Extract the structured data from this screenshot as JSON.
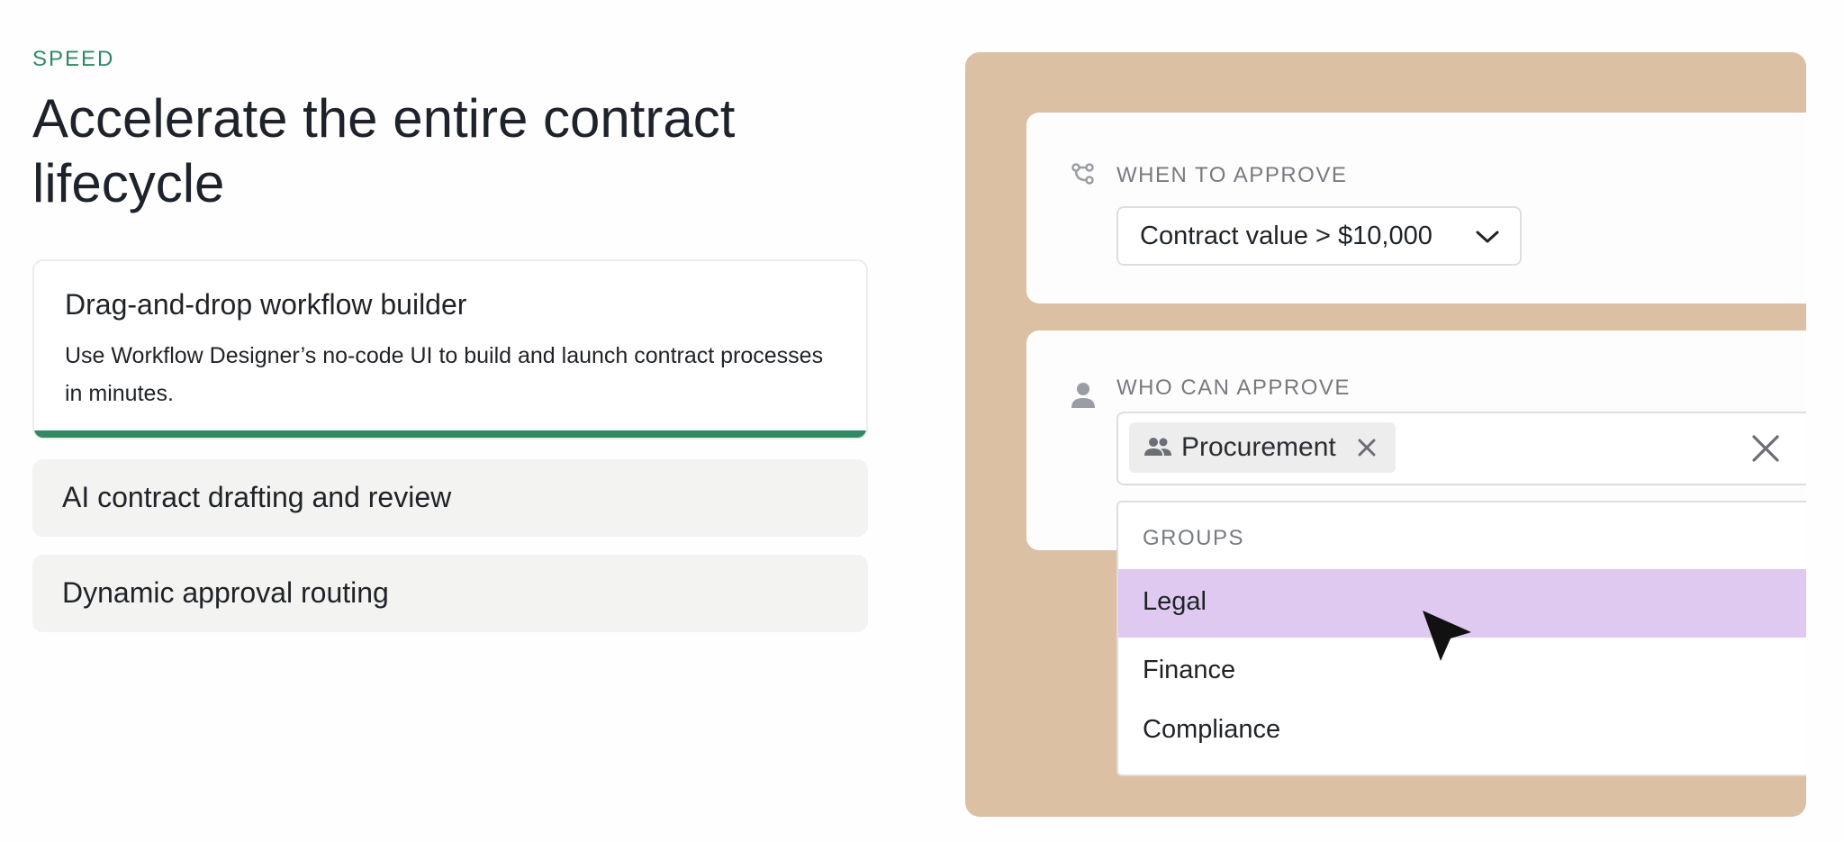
{
  "section": {
    "eyebrow": "SPEED",
    "headline": "Accelerate the entire contract lifecycle"
  },
  "features": {
    "active": {
      "title": "Drag-and-drop workflow builder",
      "description": "Use Workflow Designer’s no-code UI to build and launch contract processes in minutes.",
      "progress": 1.0
    },
    "items": [
      {
        "title": "AI contract drafting and review"
      },
      {
        "title": "Dynamic approval routing"
      }
    ]
  },
  "demo": {
    "when": {
      "icon": "branch-icon",
      "label": "WHEN TO APPROVE",
      "selected": "Contract value > $10,000"
    },
    "who": {
      "icon": "person-icon",
      "label": "WHO CAN APPROVE",
      "chips": [
        {
          "icon": "group-icon",
          "label": "Procurement"
        }
      ]
    },
    "dropdown": {
      "group_header": "GROUPS",
      "options": [
        {
          "label": "Legal",
          "highlighted": true
        },
        {
          "label": "Finance",
          "highlighted": false
        },
        {
          "label": "Compliance",
          "highlighted": false
        }
      ]
    }
  },
  "colors": {
    "accent": "#2f8a64",
    "panel_bg": "#dcc0a3",
    "highlight": "#dfc9f1",
    "inactive_card": "#f3f3f1"
  }
}
